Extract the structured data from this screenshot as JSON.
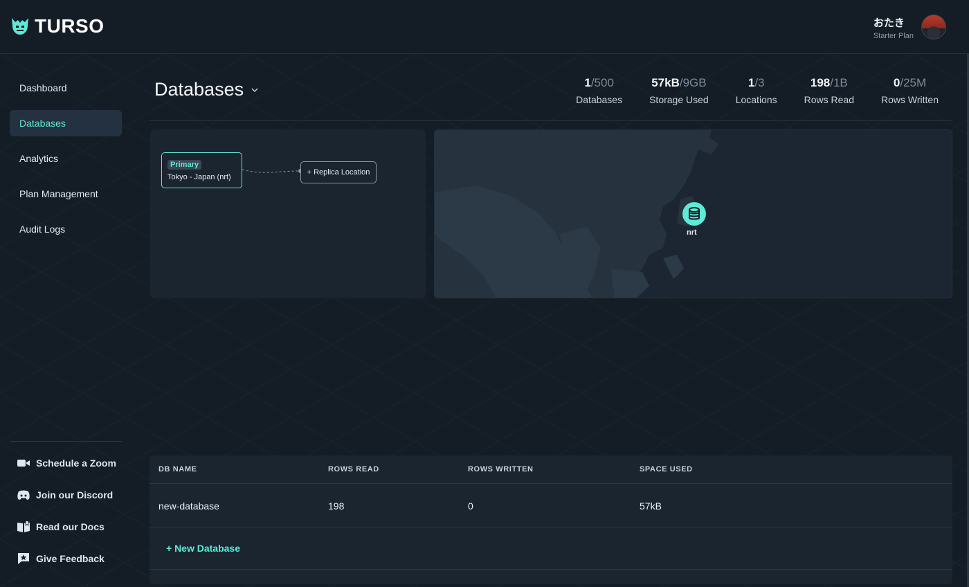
{
  "brand": {
    "name": "TURSO"
  },
  "user": {
    "name": "おたき",
    "plan": "Starter Plan"
  },
  "sidebar": {
    "items": [
      {
        "label": "Dashboard",
        "active": false
      },
      {
        "label": "Databases",
        "active": true
      },
      {
        "label": "Analytics",
        "active": false
      },
      {
        "label": "Plan Management",
        "active": false
      },
      {
        "label": "Audit Logs",
        "active": false
      }
    ],
    "bottom_links": [
      {
        "label": "Schedule a Zoom",
        "icon": "video-camera-icon"
      },
      {
        "label": "Join our Discord",
        "icon": "discord-icon"
      },
      {
        "label": "Read our Docs",
        "icon": "book-icon"
      },
      {
        "label": "Give Feedback",
        "icon": "feedback-star-icon"
      }
    ]
  },
  "main": {
    "title": "Databases",
    "stats": [
      {
        "value": "1",
        "limit": "/500",
        "label": "Databases"
      },
      {
        "value": "57kB",
        "limit": "/9GB",
        "label": "Storage Used"
      },
      {
        "value": "1",
        "limit": "/3",
        "label": "Locations"
      },
      {
        "value": "198",
        "limit": "/1B",
        "label": "Rows Read"
      },
      {
        "value": "0",
        "limit": "/25M",
        "label": "Rows Written"
      }
    ],
    "topology": {
      "primary_badge": "Primary",
      "primary_location": "Tokyo - Japan (nrt)",
      "replica_button": "+ Replica Location"
    },
    "map": {
      "pin_label": "nrt"
    }
  },
  "table": {
    "columns": [
      "DB NAME",
      "ROWS READ",
      "ROWS WRITTEN",
      "SPACE USED"
    ],
    "rows": [
      {
        "name": "new-database",
        "rows_read": "198",
        "rows_written": "0",
        "space_used": "57kB"
      }
    ],
    "new_database_label": "+ New Database"
  },
  "colors": {
    "accent": "#5eead4",
    "background": "#141d26",
    "panel": "#1a2530"
  }
}
